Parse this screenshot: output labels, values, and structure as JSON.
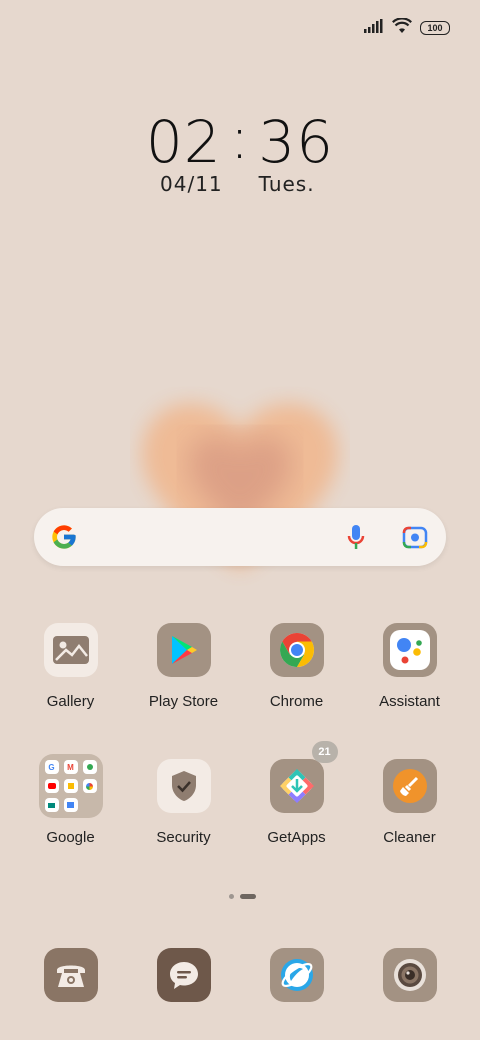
{
  "status_bar": {
    "battery": "100",
    "signal_icon": "signal-icon",
    "wifi_icon": "wifi-icon"
  },
  "clock": {
    "hours": "02",
    "minutes": "36",
    "date": "04/11",
    "day": "Tues."
  },
  "search_bar": {
    "google_icon": "google-g-icon",
    "mic_icon": "mic-icon",
    "lens_icon": "lens-icon"
  },
  "apps_row1": [
    {
      "label": "Gallery",
      "icon": "gallery-icon"
    },
    {
      "label": "Play Store",
      "icon": "play-store-icon"
    },
    {
      "label": "Chrome",
      "icon": "chrome-icon"
    },
    {
      "label": "Assistant",
      "icon": "assistant-icon"
    }
  ],
  "apps_row2": [
    {
      "label": "Google",
      "icon": "google-folder-icon"
    },
    {
      "label": "Security",
      "icon": "shield-icon"
    },
    {
      "label": "GetApps",
      "icon": "getapps-icon",
      "badge": "21"
    },
    {
      "label": "Cleaner",
      "icon": "brush-icon"
    }
  ],
  "dock": [
    {
      "icon": "phone-icon"
    },
    {
      "icon": "messages-icon"
    },
    {
      "icon": "browser-icon"
    },
    {
      "icon": "camera-icon"
    }
  ],
  "colors": {
    "background": "#e6d8ce",
    "icon_tile": "#a39283",
    "dock_phone": "#8a7565",
    "dock_messages": "#6e584a"
  }
}
